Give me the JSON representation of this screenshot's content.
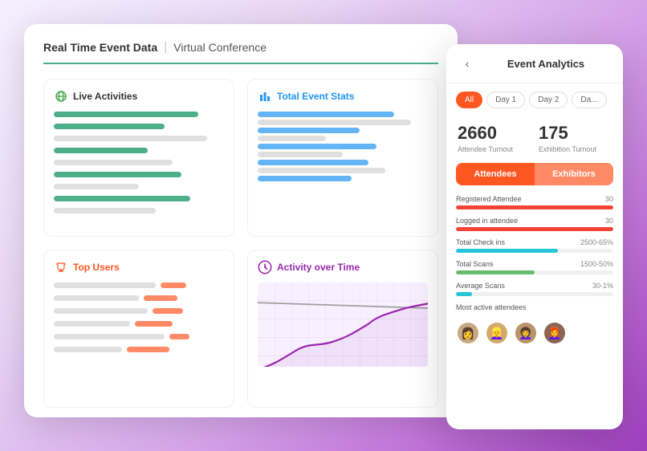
{
  "dashboard": {
    "title": "Real Time Event Data",
    "subtitle": "Virtual Conference",
    "sections": {
      "live_activities": {
        "label": "Live Activities",
        "icon": "globe-icon"
      },
      "total_event_stats": {
        "label": "Total Event Stats",
        "icon": "chart-icon"
      },
      "top_users": {
        "label": "Top Users",
        "icon": "trophy-icon"
      },
      "activity_over_time": {
        "label": "Activity over Time",
        "icon": "clock-icon"
      }
    }
  },
  "analytics_panel": {
    "title": "Event Analytics",
    "back_label": "‹",
    "tabs": [
      {
        "label": "All",
        "active": true
      },
      {
        "label": "Day 1",
        "active": false
      },
      {
        "label": "Day 2",
        "active": false
      },
      {
        "label": "Da...",
        "active": false
      }
    ],
    "stats": {
      "attendee_count": "2660",
      "attendee_label": "Attendee Turnout",
      "exhibition_count": "175",
      "exhibition_label": "Exhibition Turnout"
    },
    "toggles": [
      {
        "label": "Attendees",
        "active": true
      },
      {
        "label": "Exhibitors",
        "active": false
      }
    ],
    "metrics": [
      {
        "name": "Registered Attendee",
        "value": "30",
        "percent": 100,
        "color": "red"
      },
      {
        "name": "Logged in attendee",
        "value": "30",
        "percent": 100,
        "color": "red"
      },
      {
        "name": "Total Check ins",
        "value": "2500-65%",
        "percent": 65,
        "color": "teal"
      },
      {
        "name": "Total Scans",
        "value": "1500-50%",
        "percent": 50,
        "color": "green"
      },
      {
        "name": "Average Scans",
        "value": "30-1%",
        "percent": 10,
        "color": "teal"
      }
    ],
    "most_active_label": "Most active attendees",
    "avatars": [
      "👩",
      "👱‍♀️",
      "👩‍🦱",
      "👩‍🦰"
    ]
  }
}
